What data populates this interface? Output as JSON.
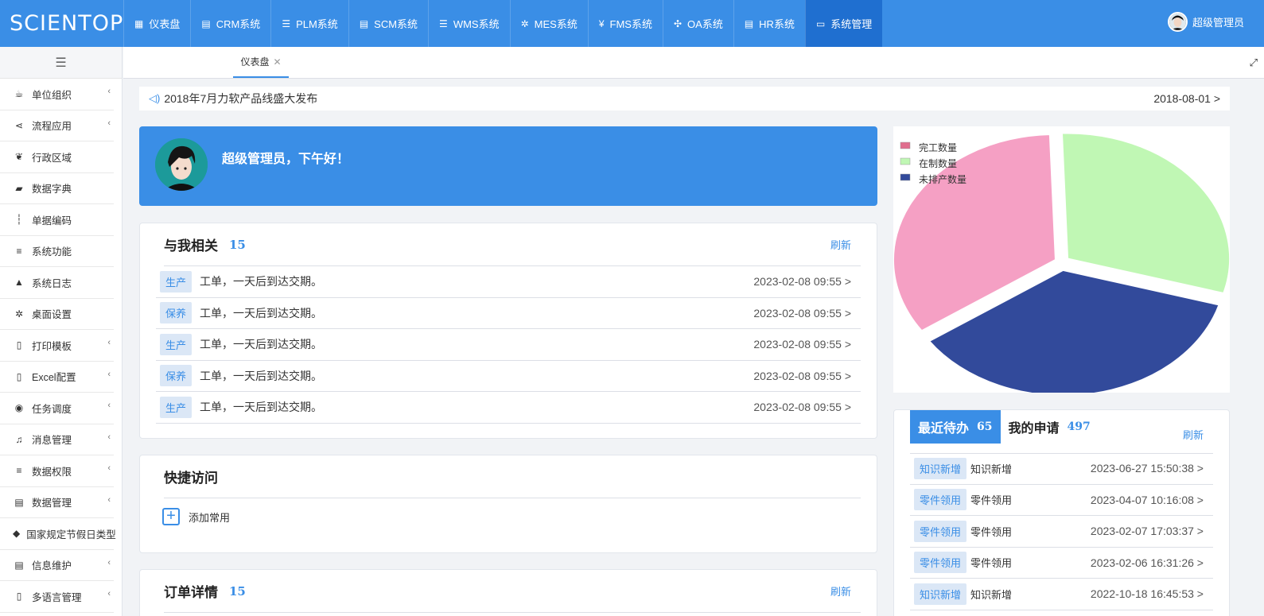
{
  "app": {
    "logo": "SCIENTOP",
    "user_name": "超级管理员"
  },
  "top_nav": [
    {
      "label": "仪表盘",
      "icon": "windows-icon",
      "glyph": "▦"
    },
    {
      "label": "CRM系统",
      "icon": "id-card-icon",
      "glyph": "▤"
    },
    {
      "label": "PLM系统",
      "icon": "server-icon",
      "glyph": "☰"
    },
    {
      "label": "SCM系统",
      "icon": "id-card-icon",
      "glyph": "▤"
    },
    {
      "label": "WMS系统",
      "icon": "server-icon",
      "glyph": "☰"
    },
    {
      "label": "MES系统",
      "icon": "gears-icon",
      "glyph": "✲"
    },
    {
      "label": "FMS系统",
      "icon": "yen-icon",
      "glyph": "¥"
    },
    {
      "label": "OA系统",
      "icon": "cross-icon",
      "glyph": "✣"
    },
    {
      "label": "HR系统",
      "icon": "id-card-icon",
      "glyph": "▤"
    },
    {
      "label": "系统管理",
      "icon": "monitor-icon",
      "glyph": "▭"
    }
  ],
  "sidebar": {
    "items": [
      {
        "label": "单位组织",
        "icon": "coffee-icon",
        "glyph": "☕",
        "arrow": true
      },
      {
        "label": "流程应用",
        "icon": "share-icon",
        "glyph": "⋖",
        "arrow": true
      },
      {
        "label": "行政区域",
        "icon": "leaf-icon",
        "glyph": "❦",
        "arrow": false
      },
      {
        "label": "数据字典",
        "icon": "book-icon",
        "glyph": "▰",
        "arrow": false
      },
      {
        "label": "单据编码",
        "icon": "barcode-icon",
        "glyph": "┆",
        "arrow": false
      },
      {
        "label": "系统功能",
        "icon": "list-icon",
        "glyph": "≡",
        "arrow": false
      },
      {
        "label": "系统日志",
        "icon": "warning-icon",
        "glyph": "▲",
        "arrow": false
      },
      {
        "label": "桌面设置",
        "icon": "gears-icon",
        "glyph": "✲",
        "arrow": false
      },
      {
        "label": "打印模板",
        "icon": "file-icon",
        "glyph": "▯",
        "arrow": true
      },
      {
        "label": "Excel配置",
        "icon": "excel-icon",
        "glyph": "▯",
        "arrow": true
      },
      {
        "label": "任务调度",
        "icon": "telegram-icon",
        "glyph": "◉",
        "arrow": true
      },
      {
        "label": "消息管理",
        "icon": "bell-icon",
        "glyph": "♫",
        "arrow": true
      },
      {
        "label": "数据权限",
        "icon": "list-icon",
        "glyph": "≡",
        "arrow": true
      },
      {
        "label": "数据管理",
        "icon": "database-icon",
        "glyph": "▤",
        "arrow": true
      },
      {
        "label": "国家规定节假日类型",
        "icon": "cube-icon",
        "glyph": "◆",
        "arrow": false
      },
      {
        "label": "信息维护",
        "icon": "id-card-icon",
        "glyph": "▤",
        "arrow": true
      },
      {
        "label": "多语言管理",
        "icon": "file-icon",
        "glyph": "▯",
        "arrow": true
      }
    ]
  },
  "tabs": [
    {
      "label": "仪表盘"
    }
  ],
  "notice": {
    "text": "2018年7月力软产品线盛大发布",
    "date": "2018-08-01 >"
  },
  "welcome": {
    "greeting": "超级管理员，下午好！"
  },
  "related": {
    "title": "与我相关",
    "count": "15",
    "refresh": "刷新",
    "rows": [
      {
        "tag": "生产",
        "text": "工单，一天后到达交期。",
        "time": "2023-02-08 09:55 >"
      },
      {
        "tag": "保养",
        "text": "工单，一天后到达交期。",
        "time": "2023-02-08 09:55 >"
      },
      {
        "tag": "生产",
        "text": "工单，一天后到达交期。",
        "time": "2023-02-08 09:55 >"
      },
      {
        "tag": "保养",
        "text": "工单，一天后到达交期。",
        "time": "2023-02-08 09:55 >"
      },
      {
        "tag": "生产",
        "text": "工单，一天后到达交期。",
        "time": "2023-02-08 09:55 >"
      }
    ]
  },
  "quick": {
    "title": "快捷访问",
    "add_label": "添加常用"
  },
  "orders": {
    "title": "订单详情",
    "count": "15",
    "refresh": "刷新"
  },
  "chart_data": {
    "type": "pie",
    "legend": [
      "完工数量",
      "在制数量",
      "未排产数量"
    ],
    "legend_position": "top-left",
    "colors": [
      "#f5a0c4",
      "#c0f7b4",
      "#324a9b"
    ],
    "legend_colors": [
      "#e06e8e",
      "#c0f7b4",
      "#324a9b"
    ],
    "values": [
      34,
      30,
      36
    ]
  },
  "todo": {
    "tabs": [
      {
        "label": "最近待办",
        "count": "65"
      },
      {
        "label": "我的申请",
        "count": "497"
      }
    ],
    "refresh": "刷新",
    "rows": [
      {
        "tag": "知识新增",
        "text": "知识新增",
        "time": "2023-06-27 15:50:38 >"
      },
      {
        "tag": "零件领用",
        "text": "零件领用",
        "time": "2023-04-07 10:16:08 >"
      },
      {
        "tag": "零件领用",
        "text": "零件领用",
        "time": "2023-02-07 17:03:37 >"
      },
      {
        "tag": "零件领用",
        "text": "零件领用",
        "time": "2023-02-06 16:31:26 >"
      },
      {
        "tag": "知识新增",
        "text": "知识新增",
        "time": "2022-10-18 16:45:53 >"
      }
    ]
  }
}
